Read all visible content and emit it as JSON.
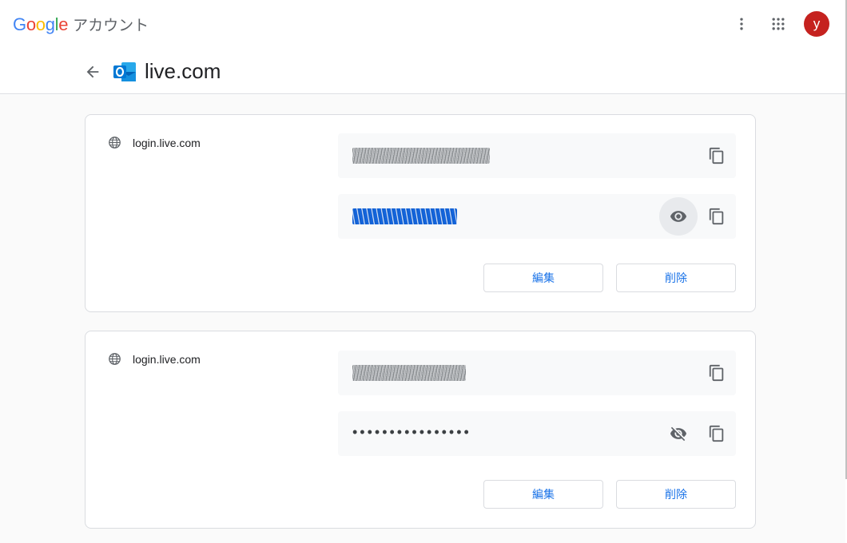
{
  "app": {
    "logo_letters": [
      {
        "ch": "G",
        "color": "#4285F4"
      },
      {
        "ch": "o",
        "color": "#EA4335"
      },
      {
        "ch": "o",
        "color": "#FBBC05"
      },
      {
        "ch": "g",
        "color": "#4285F4"
      },
      {
        "ch": "l",
        "color": "#34A853"
      },
      {
        "ch": "e",
        "color": "#EA4335"
      }
    ],
    "product_name": "アカウント",
    "header_icons": [
      "more-vert-icon",
      "apps-grid-icon"
    ],
    "avatar_initial": "y",
    "avatar_color": "#c5221f"
  },
  "site": {
    "title": "live.com",
    "icon": "outlook-icon",
    "brand_color": "#0078d4"
  },
  "credentials": [
    {
      "site_label": "login.live.com",
      "username_obscured": true,
      "password_display": "",
      "password_state": "shown-selected",
      "visibility_icon": "eye-icon",
      "copy_icon": "copy-icon",
      "edit_label": "編集",
      "delete_label": "削除"
    },
    {
      "site_label": "login.live.com",
      "username_obscured": true,
      "password_display": "••••••••••••••••",
      "password_state": "hidden",
      "visibility_icon": "eye-off-icon",
      "copy_icon": "copy-icon",
      "edit_label": "編集",
      "delete_label": "削除"
    }
  ],
  "colors": {
    "link": "#1a73e8",
    "field_bg": "#f8f9fa",
    "border": "#dadce0"
  }
}
